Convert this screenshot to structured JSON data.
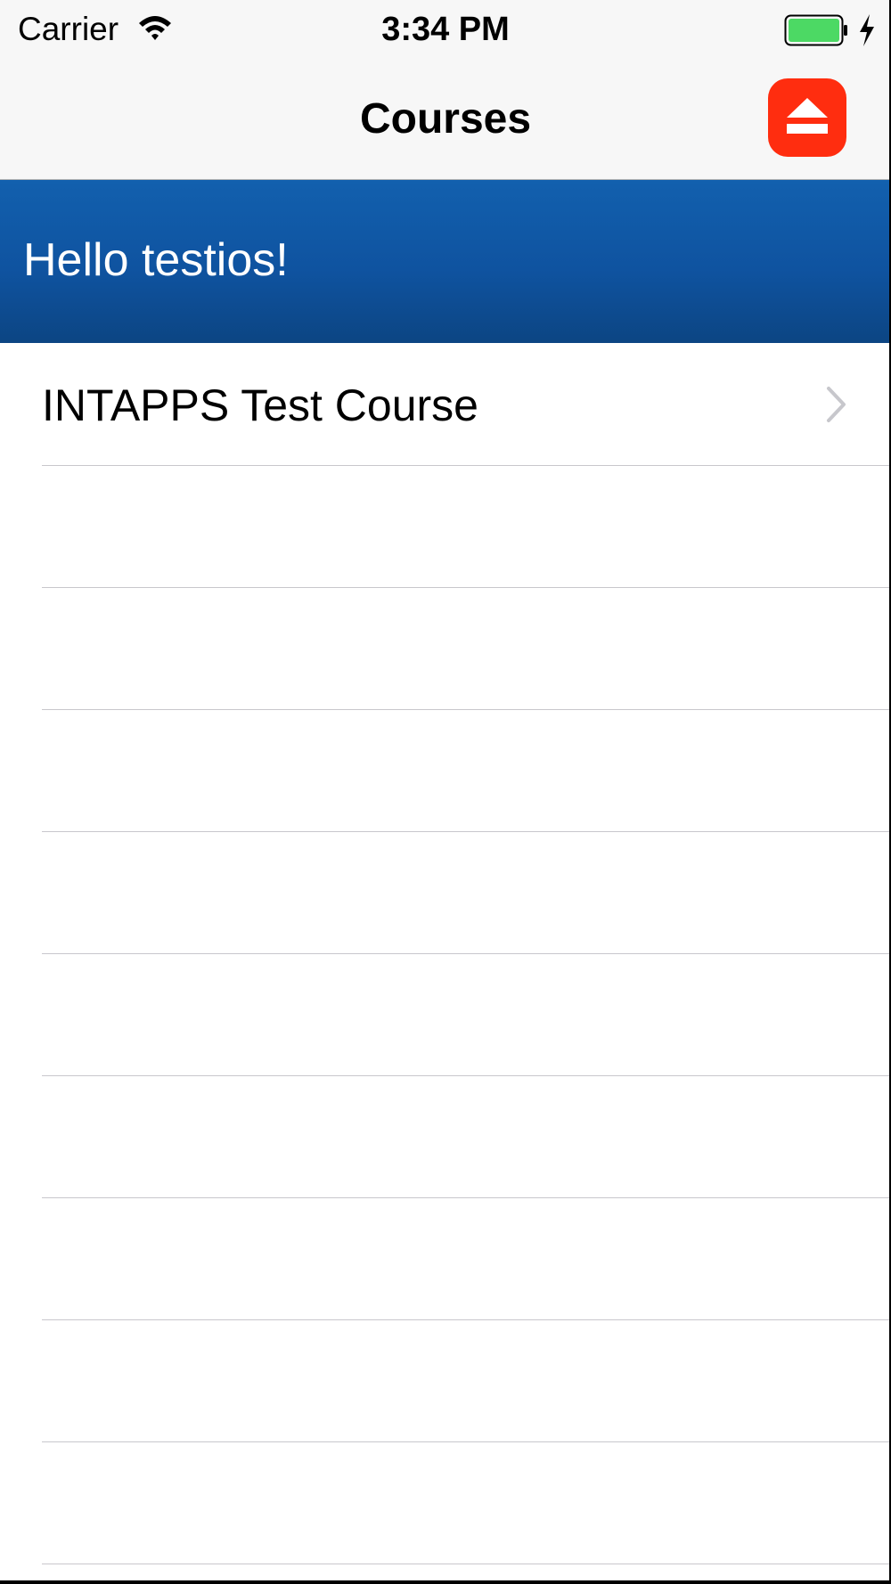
{
  "status_bar": {
    "carrier": "Carrier",
    "time": "3:34 PM",
    "wifi_icon": "wifi-icon",
    "battery_icon": "battery-icon",
    "charging_icon": "bolt-icon",
    "battery_color": "#4cd964"
  },
  "nav": {
    "title": "Courses",
    "logout_icon": "eject-icon",
    "logout_color": "#ff2d0f"
  },
  "banner": {
    "greeting": "Hello testios!",
    "color": "#1260ae"
  },
  "courses": [
    {
      "label": "INTAPPS Test Course",
      "chevron_icon": "chevron-right-icon"
    }
  ]
}
